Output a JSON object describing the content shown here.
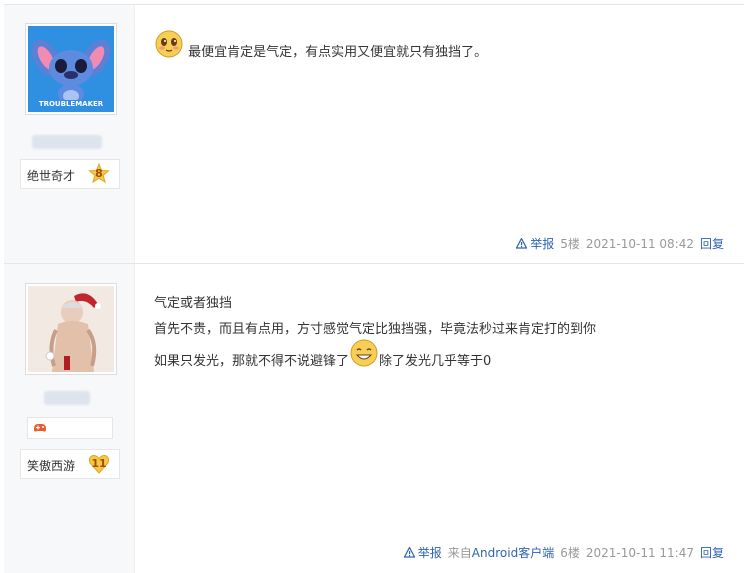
{
  "posts": [
    {
      "avatar_caption": "TROUBLEMAKER",
      "badge": {
        "label": "绝世奇才",
        "level": "8"
      },
      "content": {
        "line1": "最便宜肯定是气定，有点实用又便宜就只有独挡了。"
      },
      "footer": {
        "report": "举报",
        "floor": "5楼",
        "time": "2021-10-11 08:42",
        "reply": "回复"
      }
    },
    {
      "badge": {
        "label": "笑傲西游",
        "level": "11"
      },
      "content": {
        "line1": "气定或者独挡",
        "line2": "首先不贵，而且有点用，方寸感觉气定比独挡强，毕竟法秒过来肯定打的到你",
        "line3a": "如果只发光，那就不得不说避锋了",
        "line3b": "除了发光几乎等于0"
      },
      "footer": {
        "report": "举报",
        "source_prefix": "来自",
        "source_link": "Android客户端",
        "floor": "6楼",
        "time": "2021-10-11 11:47",
        "reply": "回复"
      }
    }
  ],
  "colors": {
    "link": "#2d64b3",
    "meta": "#999999",
    "sidebar": "#f7f8fa"
  }
}
